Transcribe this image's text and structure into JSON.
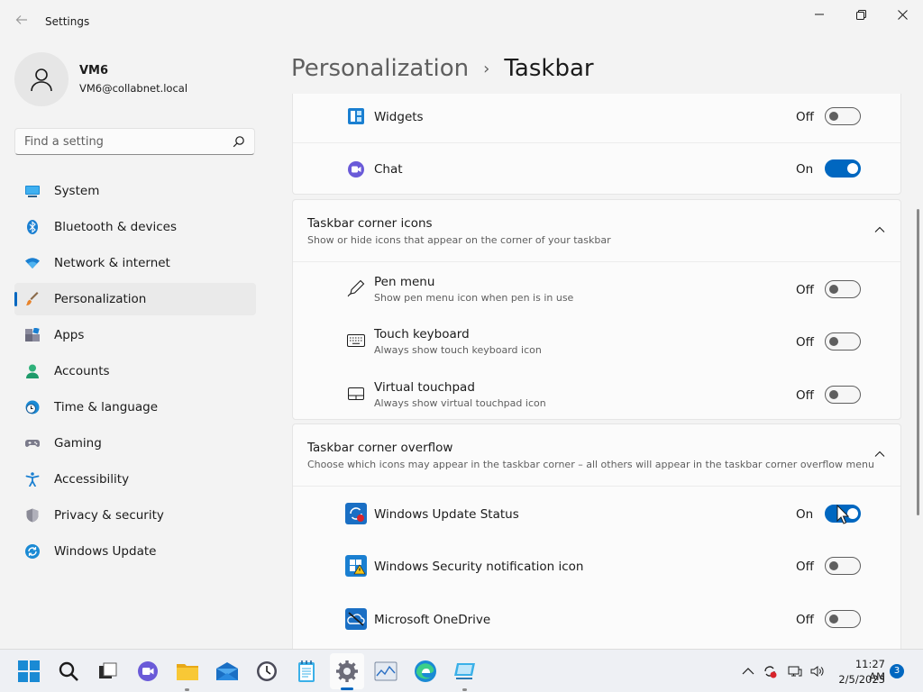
{
  "window": {
    "app_title": "Settings"
  },
  "profile": {
    "name": "VM6",
    "email": "VM6@collabnet.local"
  },
  "search": {
    "placeholder": "Find a setting"
  },
  "sidebar": {
    "items": [
      {
        "label": "System",
        "icon": "monitor-icon"
      },
      {
        "label": "Bluetooth & devices",
        "icon": "bluetooth-icon"
      },
      {
        "label": "Network & internet",
        "icon": "wifi-icon"
      },
      {
        "label": "Personalization",
        "icon": "brush-icon",
        "active": true
      },
      {
        "label": "Apps",
        "icon": "apps-icon"
      },
      {
        "label": "Accounts",
        "icon": "person-icon"
      },
      {
        "label": "Time & language",
        "icon": "clock-globe-icon"
      },
      {
        "label": "Gaming",
        "icon": "gamepad-icon"
      },
      {
        "label": "Accessibility",
        "icon": "accessibility-icon"
      },
      {
        "label": "Privacy & security",
        "icon": "shield-icon"
      },
      {
        "label": "Windows Update",
        "icon": "sync-icon"
      }
    ]
  },
  "breadcrumb": {
    "parent": "Personalization",
    "separator": "›",
    "current": "Taskbar"
  },
  "taskbar_items": {
    "widgets": {
      "title": "Widgets",
      "state": "Off",
      "on": false
    },
    "chat": {
      "title": "Chat",
      "state": "On",
      "on": true
    }
  },
  "corner_icons": {
    "title": "Taskbar corner icons",
    "subtitle": "Show or hide icons that appear on the corner of your taskbar",
    "items": [
      {
        "title": "Pen menu",
        "subtitle": "Show pen menu icon when pen is in use",
        "state": "Off",
        "on": false
      },
      {
        "title": "Touch keyboard",
        "subtitle": "Always show touch keyboard icon",
        "state": "Off",
        "on": false
      },
      {
        "title": "Virtual touchpad",
        "subtitle": "Always show virtual touchpad icon",
        "state": "Off",
        "on": false
      }
    ]
  },
  "corner_overflow": {
    "title": "Taskbar corner overflow",
    "subtitle": "Choose which icons may appear in the taskbar corner – all others will appear in the taskbar corner overflow menu",
    "items": [
      {
        "title": "Windows Update Status",
        "state": "On",
        "on": true
      },
      {
        "title": "Windows Security notification icon",
        "state": "Off",
        "on": false
      },
      {
        "title": "Microsoft OneDrive",
        "state": "Off",
        "on": false
      }
    ]
  },
  "system_tray": {
    "time": "11:27 AM",
    "date": "2/5/2023",
    "notification_count": "3"
  },
  "colors": {
    "accent": "#0067c0",
    "background": "#f3f3f3",
    "card": "#fbfbfb"
  }
}
